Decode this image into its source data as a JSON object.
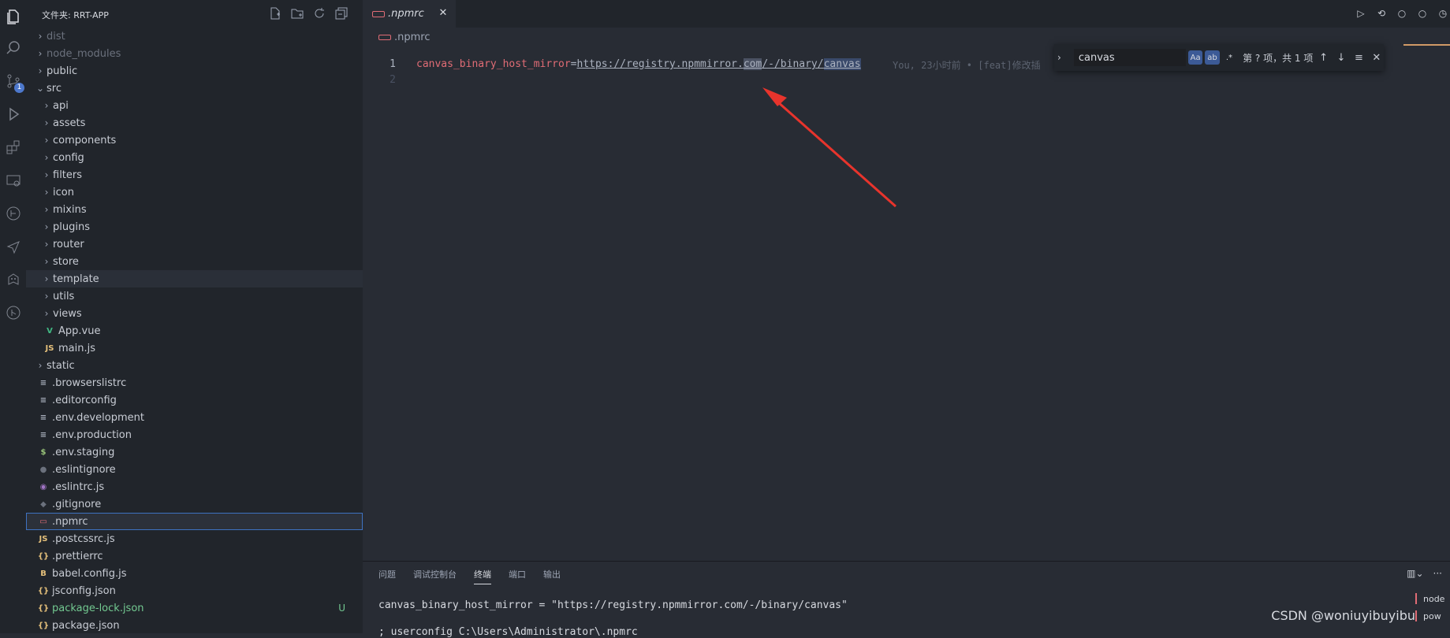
{
  "explorer": {
    "title": "文件夹: RRT-APP",
    "actions": [
      "new-file-icon",
      "new-folder-icon",
      "refresh-icon",
      "collapse-icon"
    ]
  },
  "activity": {
    "scm_badge": "1"
  },
  "tree": [
    {
      "label": "dist",
      "type": "folder",
      "depth": 0,
      "dim": true
    },
    {
      "label": "node_modules",
      "type": "folder",
      "depth": 0,
      "dim": true
    },
    {
      "label": "public",
      "type": "folder",
      "depth": 0
    },
    {
      "label": "src",
      "type": "folder-open",
      "depth": 0
    },
    {
      "label": "api",
      "type": "folder",
      "depth": 1
    },
    {
      "label": "assets",
      "type": "folder",
      "depth": 1
    },
    {
      "label": "components",
      "type": "folder",
      "depth": 1
    },
    {
      "label": "config",
      "type": "folder",
      "depth": 1
    },
    {
      "label": "filters",
      "type": "folder",
      "depth": 1
    },
    {
      "label": "icon",
      "type": "folder",
      "depth": 1
    },
    {
      "label": "mixins",
      "type": "folder",
      "depth": 1
    },
    {
      "label": "plugins",
      "type": "folder",
      "depth": 1
    },
    {
      "label": "router",
      "type": "folder",
      "depth": 1
    },
    {
      "label": "store",
      "type": "folder",
      "depth": 1
    },
    {
      "label": "template",
      "type": "folder",
      "depth": 1,
      "hover": true
    },
    {
      "label": "utils",
      "type": "folder",
      "depth": 1
    },
    {
      "label": "views",
      "type": "folder",
      "depth": 1
    },
    {
      "label": "App.vue",
      "type": "vue",
      "depth": 1
    },
    {
      "label": "main.js",
      "type": "js",
      "depth": 1
    },
    {
      "label": "static",
      "type": "folder",
      "depth": 0
    },
    {
      "label": ".browserslistrc",
      "type": "lines",
      "depth": 0
    },
    {
      "label": ".editorconfig",
      "type": "lines",
      "depth": 0
    },
    {
      "label": ".env.development",
      "type": "lines",
      "depth": 0
    },
    {
      "label": ".env.production",
      "type": "lines",
      "depth": 0
    },
    {
      "label": ".env.staging",
      "type": "dollar",
      "depth": 0
    },
    {
      "label": ".eslintignore",
      "type": "eslint-ignore",
      "depth": 0
    },
    {
      "label": ".eslintrc.js",
      "type": "eslint",
      "depth": 0
    },
    {
      "label": ".gitignore",
      "type": "git",
      "depth": 0
    },
    {
      "label": ".npmrc",
      "type": "npm",
      "depth": 0,
      "selected": true
    },
    {
      "label": ".postcssrc.js",
      "type": "js",
      "depth": 0
    },
    {
      "label": ".prettierrc",
      "type": "json",
      "depth": 0
    },
    {
      "label": "babel.config.js",
      "type": "babel",
      "depth": 0
    },
    {
      "label": "jsconfig.json",
      "type": "json",
      "depth": 0
    },
    {
      "label": "package-lock.json",
      "type": "json",
      "depth": 0,
      "modified": true,
      "git_status": "U"
    },
    {
      "label": "package.json",
      "type": "json",
      "depth": 0
    }
  ],
  "tab": {
    "label": ".npmrc"
  },
  "breadcrumb": ".npmrc",
  "code": {
    "line_numbers": [
      "1",
      "2"
    ],
    "key": "canvas_binary_host_mirror",
    "eq": "=",
    "url_a": "https://registry.npmmirror.",
    "url_com": "com",
    "url_b": "/-/binary/",
    "url_match": "canvas",
    "blame": "You, 23小时前 • [feat]修改插"
  },
  "find": {
    "query": "canvas",
    "match_case": "Aa",
    "whole_word": "ab",
    "regex": ".*",
    "count": "第 ? 项，共 1 项"
  },
  "panel": {
    "tabs": [
      "问题",
      "调试控制台",
      "终端",
      "端口",
      "输出"
    ],
    "active_tab": "终端",
    "terminal_line1": "canvas_binary_host_mirror = \"https://registry.npmmirror.com/-/binary/canvas\"",
    "terminal_line2": "; userconfig C:\\Users\\Administrator\\.npmrc",
    "terminals": [
      "node",
      "pow"
    ]
  },
  "watermark": "CSDN @woniuyibuyibu",
  "colors": {
    "accent": "#e06c75",
    "selection": "#3e72c1",
    "arrow": "#e8342c"
  }
}
